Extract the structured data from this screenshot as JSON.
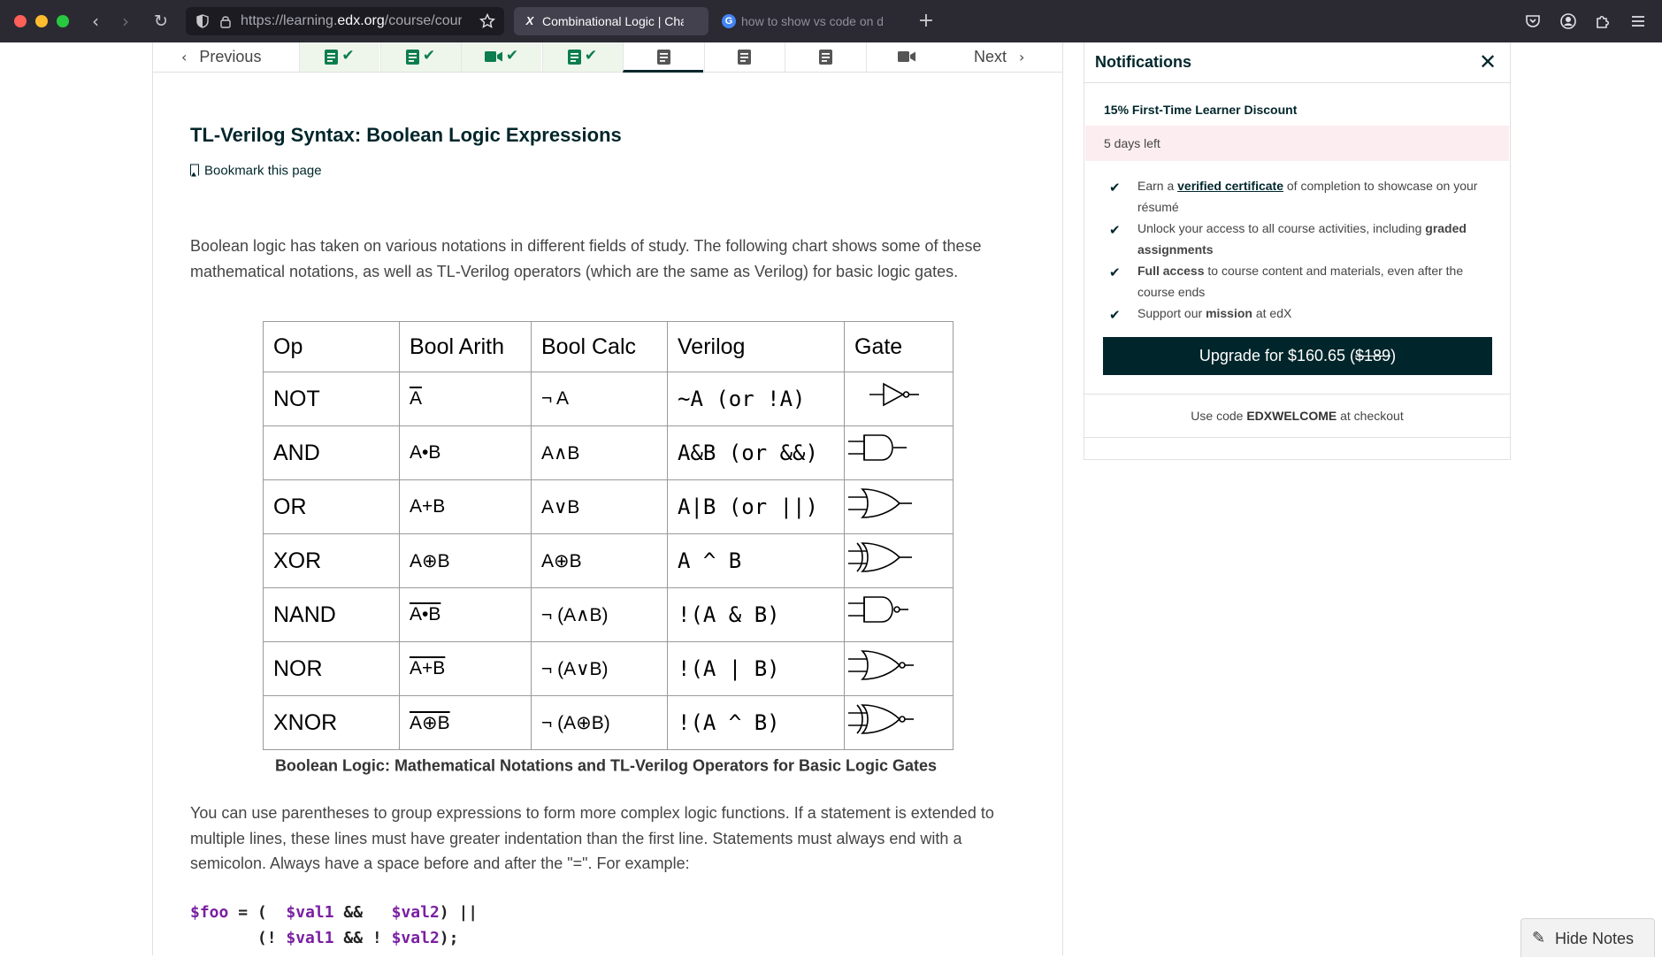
{
  "browser": {
    "url_prefix": "https://learning.",
    "url_host": "edx.org",
    "url_path": "/course/cours",
    "tabs": [
      {
        "label": "Combinational Logic | Chap",
        "icon": "X"
      },
      {
        "label": "how to show vs code on d",
        "icon": "G"
      }
    ],
    "back_icon": "‹",
    "forward_icon": "›",
    "reload_icon": "↻",
    "new_tab_icon": "+"
  },
  "sequence_nav": {
    "previous_label": "Previous",
    "next_label": "Next",
    "units": [
      {
        "type": "text",
        "complete": true
      },
      {
        "type": "text",
        "complete": true
      },
      {
        "type": "video",
        "complete": true
      },
      {
        "type": "text",
        "complete": true
      },
      {
        "type": "text",
        "complete": false,
        "current": true
      },
      {
        "type": "text",
        "complete": false
      },
      {
        "type": "text",
        "complete": false
      },
      {
        "type": "video",
        "complete": false
      }
    ],
    "check_glyph": "✔"
  },
  "content": {
    "title": "TL-Verilog Syntax: Boolean Logic Expressions",
    "bookmark_label": "Bookmark this page",
    "intro_paragraph": "Boolean logic has taken on various notations in different fields of study. The following chart shows some of these mathematical notations, as well as TL-Verilog operators (which are the same as Verilog) for basic logic gates.",
    "table": {
      "headers": [
        "Op",
        "Bool Arith",
        "Bool Calc",
        "Verilog",
        "Gate"
      ],
      "rows": [
        {
          "op": "NOT",
          "arith": "A",
          "arith_overline": true,
          "calc": "¬ A",
          "verilog": "~A (or !A)",
          "gate": "not"
        },
        {
          "op": "AND",
          "arith": "A•B",
          "arith_overline": false,
          "calc": "A∧B",
          "verilog": "A&B (or &&)",
          "gate": "and"
        },
        {
          "op": "OR",
          "arith": "A+B",
          "arith_overline": false,
          "calc": "A∨B",
          "verilog": "A|B (or ||)",
          "gate": "or"
        },
        {
          "op": "XOR",
          "arith": "A⊕B",
          "arith_overline": false,
          "calc": "A⊕B",
          "verilog": "A ^ B",
          "gate": "xor"
        },
        {
          "op": "NAND",
          "arith": "A•B",
          "arith_overline": true,
          "calc": "¬ (A∧B)",
          "verilog": "!(A & B)",
          "gate": "nand"
        },
        {
          "op": "NOR",
          "arith": "A+B",
          "arith_overline": true,
          "calc": "¬ (A∨B)",
          "verilog": "!(A | B)",
          "gate": "nor"
        },
        {
          "op": "XNOR",
          "arith": "A⊕B",
          "arith_overline": true,
          "calc": "¬ (A⊕B)",
          "verilog": "!(A ^ B)",
          "gate": "xnor"
        }
      ]
    },
    "caption": "Boolean Logic: Mathematical Notations and TL-Verilog Operators for Basic Logic Gates",
    "second_paragraph": "You can use parentheses to group expressions to form more complex logic functions. If a statement is extended to multiple lines, these lines must have greater indentation than the first line. Statements must always end with a semicolon. Always have a space before and after the \"=\". For example:",
    "code": {
      "line1_var": "$foo",
      "line1_mid": " = (  ",
      "line1_v1": "$val1",
      "line1_op": " &&   ",
      "line1_v2": "$val2",
      "line1_end": ") ||",
      "line2_pre": "       (! ",
      "line2_v1": "$val1",
      "line2_op": " && ! ",
      "line2_v2": "$val2",
      "line2_end": ");"
    }
  },
  "notifications": {
    "title": "Notifications",
    "close_icon": "✕",
    "discount_title": "15% First-Time Learner Discount",
    "days_left": "5 days left",
    "benefits": [
      {
        "pre": "Earn a ",
        "link": "verified certificate",
        "post": " of completion to showcase on your résumé"
      },
      {
        "pre": "Unlock your access to all course activities, including ",
        "bold": "graded assignments",
        "post": ""
      },
      {
        "bold_first": "Full access",
        "post": " to course content and materials, even after the course ends"
      },
      {
        "pre": "Support our ",
        "bold": "mission",
        "post": " at edX"
      }
    ],
    "check_glyph": "✔",
    "upgrade_prefix": "Upgrade for $160.65 (",
    "upgrade_strike": "$189",
    "upgrade_suffix": ")",
    "promo_pre": "Use code ",
    "promo_code": "EDXWELCOME",
    "promo_post": " at checkout"
  },
  "hide_notes_label": "Hide Notes",
  "colors": {
    "brand_dark": "#00262b",
    "complete_green": "#0d7d4d",
    "discount_bg": "#fcedf0",
    "code_variable": "#7a1fa2"
  }
}
